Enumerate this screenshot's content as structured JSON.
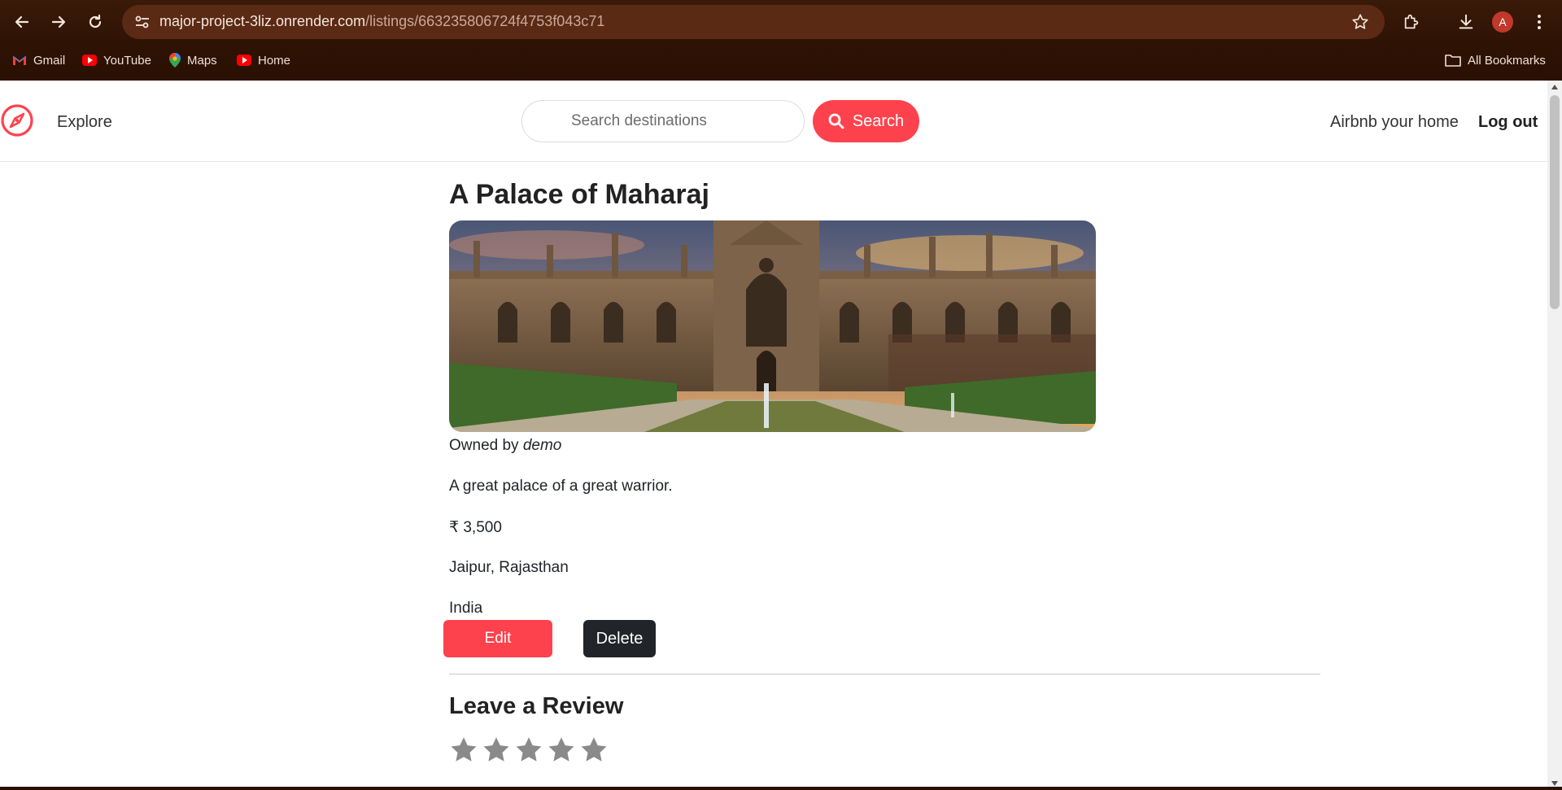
{
  "browser": {
    "url_host": "major-project-3liz.onrender.com",
    "url_path": "/listings/663235806724f4753f043c71",
    "profile_initial": "A",
    "bookmarks": [
      {
        "label": "Gmail",
        "icon": "gmail-icon"
      },
      {
        "label": "YouTube",
        "icon": "youtube-icon"
      },
      {
        "label": "Maps",
        "icon": "maps-icon"
      },
      {
        "label": "Home",
        "icon": "youtube-icon"
      }
    ],
    "all_bookmarks_label": "All Bookmarks"
  },
  "navbar": {
    "brand_icon": "compass-icon",
    "explore_label": "Explore",
    "search_placeholder": "Search destinations",
    "search_button_label": "Search",
    "host_label": "Airbnb your home",
    "logout_label": "Log out"
  },
  "listing": {
    "title": "A Palace of Maharaj",
    "owned_by_prefix": "Owned by",
    "owner": "demo",
    "description": "A great palace of a great warrior.",
    "price": "₹ 3,500",
    "location": "Jaipur, Rajasthan",
    "country": "India",
    "edit_label": "Edit",
    "delete_label": "Delete"
  },
  "review": {
    "heading": "Leave a Review",
    "max_rating": 5,
    "selected_rating": 0
  },
  "colors": {
    "accent": "#fe424d",
    "dark_button": "#212529",
    "chrome_bg": "#2e1305",
    "omnibox_bg": "#5a2a14"
  }
}
